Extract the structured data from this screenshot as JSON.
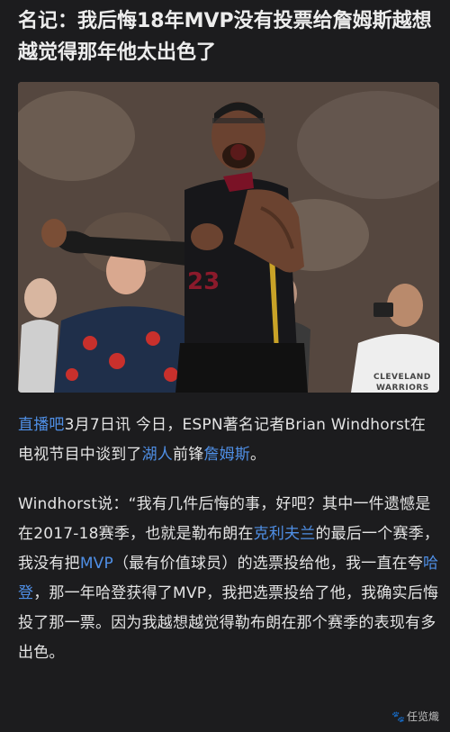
{
  "article": {
    "title": "名记：我后悔18年MVP没有投票给詹姆斯越想越觉得那年他太出色了",
    "photo": {
      "shirt_text_1": "CLEVELAND",
      "shirt_text_2": "WARRIORS",
      "jersey_number": "23"
    },
    "paragraph1": {
      "source_link": "直播吧",
      "text1": "3月7日讯 今日，ESPN著名记者Brian Windhorst在电视节目中谈到了",
      "team_link": "湖人",
      "text2": "前锋",
      "player_link": "詹姆斯",
      "text3": "。"
    },
    "paragraph2": {
      "text1": "Windhorst说：“我有几件后悔的事，好吧？其中一件遗憾是在2017-18赛季，也就是勒布朗在",
      "city_link": "克利夫兰",
      "text2": "的最后一个赛季，我没有把",
      "mvp_link": "MVP",
      "text3": "（最有价值球员）的选票投给他，我一直在夸",
      "harden_link": "哈登",
      "text4": "，那一年哈登获得了MVP，我把选票投给了他，我确实后悔投了那一票。因为我越想越觉得勒布朗在那个赛季的表现有多出色。"
    }
  },
  "watermark": {
    "icon": "paw-icon",
    "text": "任览熾"
  },
  "colors": {
    "background": "#1c1c1e",
    "link": "#4f8fe6",
    "text": "#e4e4e4"
  }
}
